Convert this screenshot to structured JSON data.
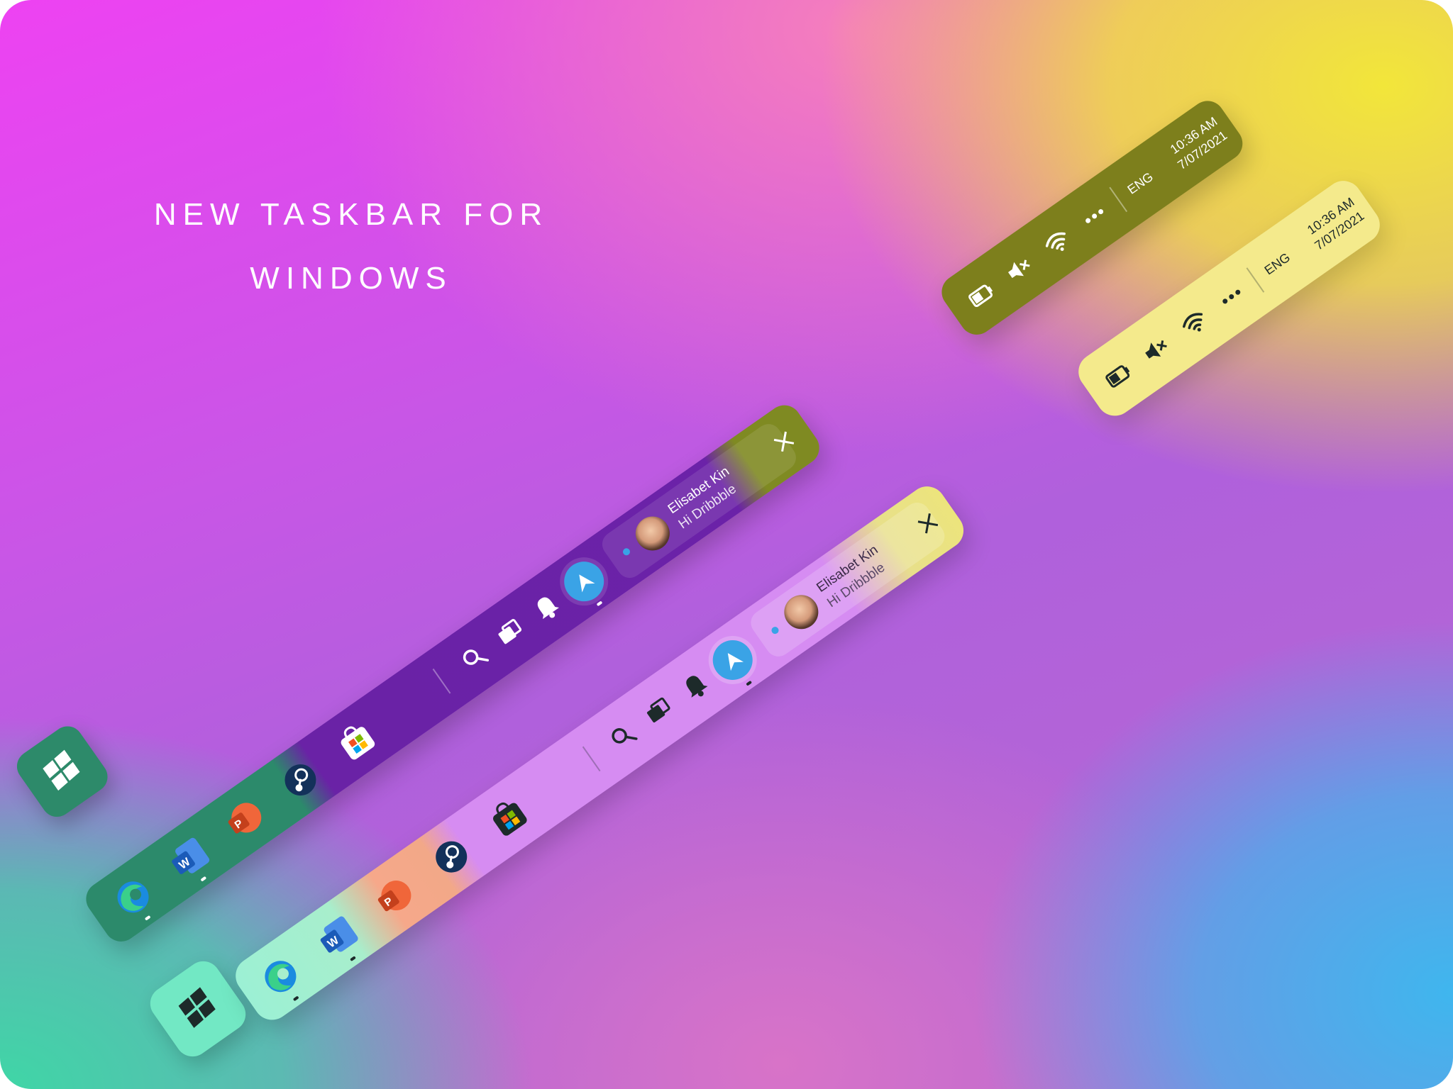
{
  "headline": {
    "line1": "NEW TASKBAR FOR",
    "line2": "WINDOWS"
  },
  "taskbars": [
    {
      "variant": "dark",
      "accent_colors": {
        "start": "#2c8a6b",
        "apps": "#2c8a6b",
        "center": "#6b22a8",
        "close_area": "#7f8a22",
        "tray": "#7d7f1c"
      },
      "apps": [
        "edge-icon",
        "word-icon",
        "powerpoint-icon",
        "steam-icon",
        "store-icon"
      ],
      "tools": [
        "search-icon",
        "task-view-icon",
        "bell-icon",
        "telegram-icon"
      ],
      "notification": {
        "name": "Elisabet Kin",
        "message": "Hi Dribbble"
      },
      "tray": {
        "language": "ENG",
        "time": "10:36 AM",
        "date": "7/07/2021"
      }
    },
    {
      "variant": "light",
      "accent_colors": {
        "start": "#6ee8c4",
        "apps": "#9ef0d2",
        "center": "#d58df0",
        "close_area": "#e9e27a",
        "tray": "#f4ea8a"
      },
      "apps": [
        "edge-icon",
        "word-icon",
        "powerpoint-icon",
        "steam-icon",
        "store-icon"
      ],
      "tools": [
        "search-icon",
        "task-view-icon",
        "bell-icon",
        "telegram-icon"
      ],
      "notification": {
        "name": "Elisabet Kin",
        "message": "Hi Dribbble"
      },
      "tray": {
        "language": "ENG",
        "time": "10:36 AM",
        "date": "7/07/2021"
      }
    }
  ]
}
